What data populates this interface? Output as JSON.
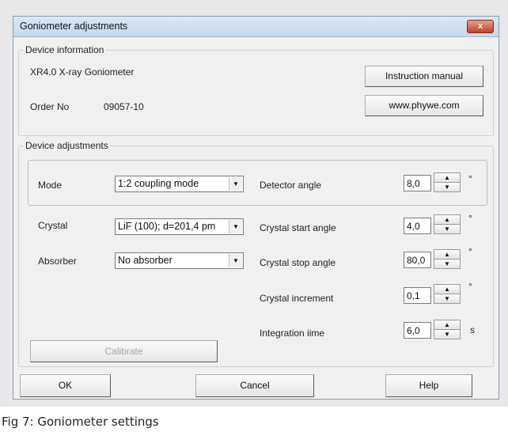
{
  "window": {
    "title": "Goniometer adjustments",
    "close_label": "x"
  },
  "device_information": {
    "legend": "Device information",
    "device_name": "XR4.0 X-ray Goniometer",
    "order_label": "Order No",
    "order_value": "09057-10",
    "manual_button": "Instruction manual",
    "website_button": "www.phywe.com"
  },
  "device_adjustments": {
    "legend": "Device adjustments",
    "mode_label": "Mode",
    "mode_value": "1:2 coupling mode",
    "crystal_label": "Crystal",
    "crystal_value": "LiF (100); d=201,4 pm",
    "absorber_label": "Absorber",
    "absorber_value": "No absorber",
    "calibrate_button": "Calibrate",
    "detector_angle": {
      "label": "Detector angle",
      "value": "8,0",
      "unit": "°"
    },
    "crystal_start_angle": {
      "label": "Crystal start angle",
      "value": "4,0",
      "unit": "°"
    },
    "crystal_stop_angle": {
      "label": "Crystal stop angle",
      "value": "80,0",
      "unit": "°"
    },
    "crystal_increment": {
      "label": "Crystal increment",
      "value": "0,1",
      "unit": "°"
    },
    "integration_time": {
      "label": "Integration iime",
      "value": "6,0",
      "unit": "s"
    }
  },
  "footer": {
    "ok": "OK",
    "cancel": "Cancel",
    "help": "Help"
  },
  "caption": "Fig 7: Goniometer settings",
  "icons": {
    "dropdown": "chevron-down-icon",
    "spin_up": "arrow-up-icon",
    "spin_down": "arrow-down-icon",
    "close": "close-icon"
  },
  "colors": {
    "close_button": "#c0412a",
    "titlebar": "#c6d8ec",
    "dialog_bg": "#f0f0f0"
  }
}
